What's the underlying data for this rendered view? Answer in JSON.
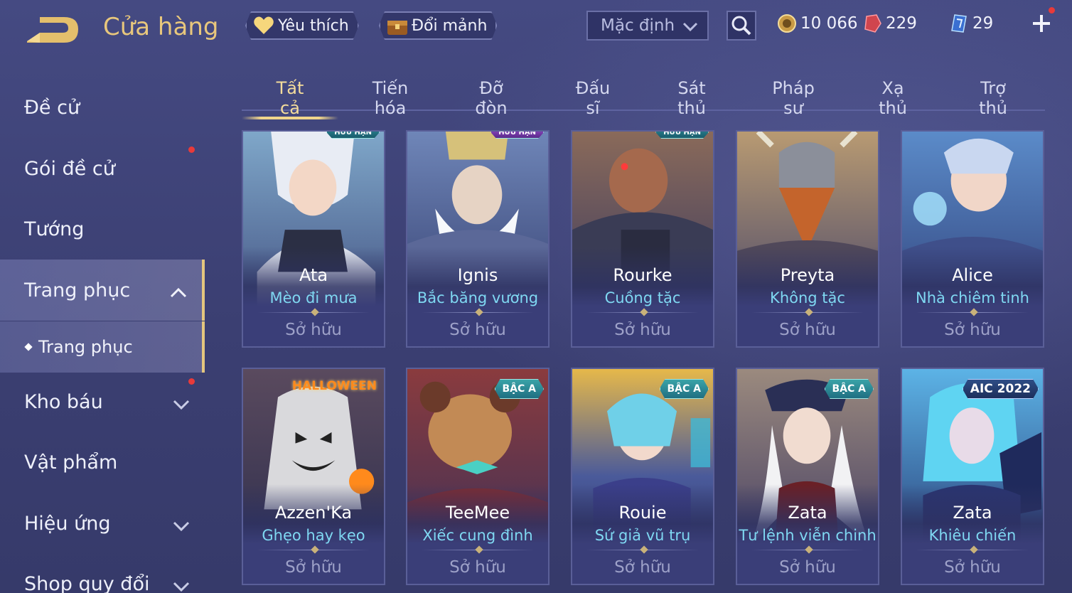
{
  "header": {
    "title": "Cửa hàng",
    "favorite_label": "Yêu thích",
    "exchange_label": "Đổi mảnh",
    "sort_value": "Mặc định",
    "currencies": [
      {
        "icon": "gold-coin-icon",
        "value": "10 066"
      },
      {
        "icon": "red-gem-icon",
        "value": "229"
      },
      {
        "icon": "voucher-icon",
        "value": "29"
      }
    ]
  },
  "sidebar": {
    "items": [
      {
        "label": "Đề cử"
      },
      {
        "label": "Gói đề cử"
      },
      {
        "label": "Tướng"
      },
      {
        "label": "Trang phục"
      },
      {
        "label": "Kho báu"
      },
      {
        "label": "Vật phẩm"
      },
      {
        "label": "Hiệu ứng"
      },
      {
        "label": "Shop quy đổi"
      }
    ],
    "sub_item": "Trang phục"
  },
  "tabs": [
    "Tất cả",
    "Tiến hóa",
    "Đỡ đòn",
    "Đấu sĩ",
    "Sát thủ",
    "Pháp sư",
    "Xạ thủ",
    "Trợ thủ"
  ],
  "cards": [
    {
      "name": "Ata",
      "skin": "Mèo đi mưa",
      "status": "Sở hữu",
      "badge": "HỮU HẠN"
    },
    {
      "name": "Ignis",
      "skin": "Bắc băng vương",
      "status": "Sở hữu",
      "badge": "HỮU HẠN"
    },
    {
      "name": "Rourke",
      "skin": "Cuồng tặc",
      "status": "Sở hữu",
      "badge": "HỮU HẠN"
    },
    {
      "name": "Preyta",
      "skin": "Không tặc",
      "status": "Sở hữu",
      "badge": ""
    },
    {
      "name": "Alice",
      "skin": "Nhà chiêm tinh",
      "status": "Sở hữu",
      "badge": ""
    },
    {
      "name": "Azzen'Ka",
      "skin": "Ghẹo hay kẹo",
      "status": "Sở hữu",
      "badge": "HALLOWEEN"
    },
    {
      "name": "TeeMee",
      "skin": "Xiếc cung đình",
      "status": "Sở hữu",
      "badge": "BẬC A"
    },
    {
      "name": "Rouie",
      "skin": "Sứ giả vũ trụ",
      "status": "Sở hữu",
      "badge": "BẬC A"
    },
    {
      "name": "Zata",
      "skin": "Tư lệnh viễn chinh",
      "status": "Sở hữu",
      "badge": "BẬC A"
    },
    {
      "name": "Zata",
      "skin": "Khiêu chiến",
      "status": "Sở hữu",
      "badge": "AIC 2022"
    }
  ]
}
